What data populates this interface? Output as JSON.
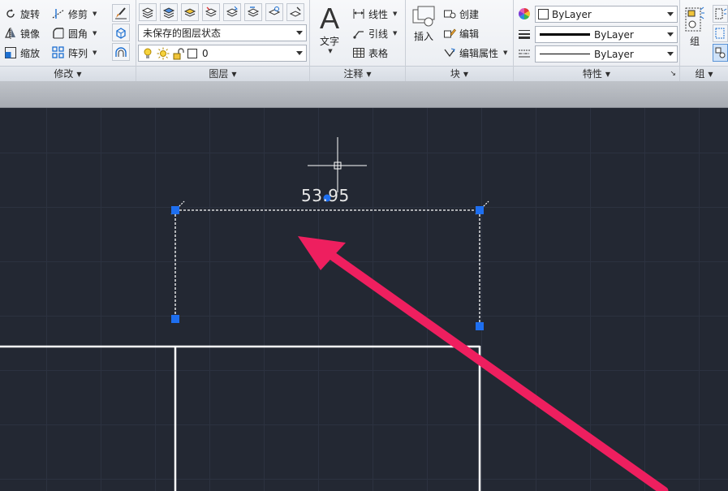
{
  "modify_panel": {
    "title": "修改",
    "rotate": "旋转",
    "trim": "修剪",
    "mirror": "镜像",
    "fillet": "圆角",
    "scale": "缩放",
    "array": "阵列"
  },
  "layers_panel": {
    "title": "图层",
    "layer_state": "未保存的图层状态",
    "current_layer": "0"
  },
  "annotation_panel": {
    "title": "注释",
    "text": "文字",
    "linear": "线性",
    "leader": "引线",
    "table": "表格"
  },
  "block_panel": {
    "title": "块",
    "insert": "插入",
    "create": "创建",
    "edit": "编辑",
    "edit_attributes": "编辑属性"
  },
  "properties_panel": {
    "title": "特性",
    "color": "ByLayer",
    "lineweight": "ByLayer",
    "linetype": "ByLayer"
  },
  "group_panel": {
    "title": "组",
    "group": "组"
  },
  "drawing": {
    "dimension_value": "53.95"
  },
  "colors": {
    "canvas": "#232833",
    "grip": "#1e6ff0",
    "arrow": "#ee1f5f"
  }
}
